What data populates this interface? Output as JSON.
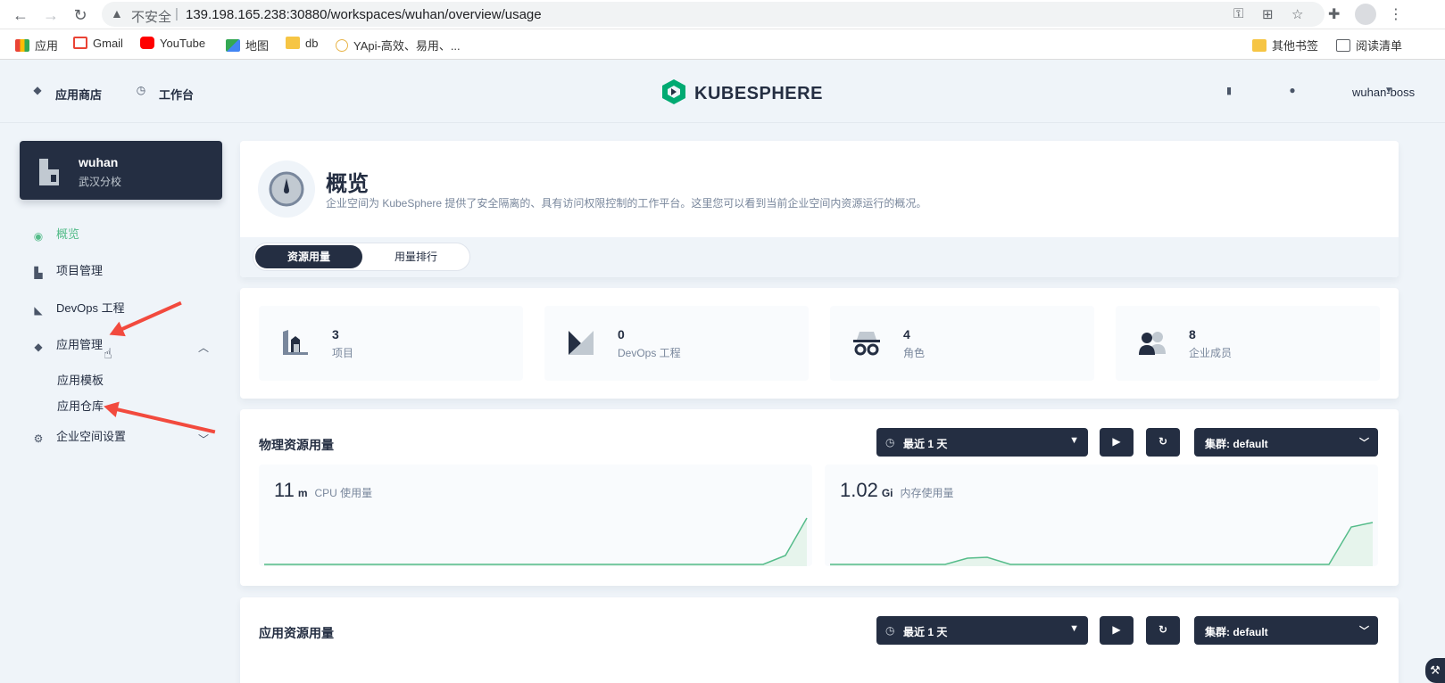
{
  "browser": {
    "insecure_label": "不安全",
    "url": "139.198.165.238:30880/workspaces/wuhan/overview/usage",
    "bookmarks": [
      "应用",
      "Gmail",
      "YouTube",
      "地图",
      "db",
      "YApi-高效、易用、..."
    ],
    "other_bookmarks": "其他书签",
    "reading_list": "阅读清单"
  },
  "header": {
    "app_store": "应用商店",
    "workbench": "工作台",
    "logo": "KUBESPHERE",
    "user": "wuhan-boss"
  },
  "workspace": {
    "name": "wuhan",
    "alias": "武汉分校"
  },
  "sidebar": {
    "overview": "概览",
    "projects": "项目管理",
    "devops": "DevOps 工程",
    "app_management": "应用管理",
    "app_templates": "应用模板",
    "app_repos": "应用仓库",
    "workspace_settings": "企业空间设置"
  },
  "overview": {
    "title": "概览",
    "description": "企业空间为 KubeSphere 提供了安全隔离的、具有访问权限控制的工作平台。这里您可以看到当前企业空间内资源运行的概况。",
    "tabs": [
      "资源用量",
      "用量排行"
    ]
  },
  "stats": [
    {
      "value": "3",
      "label": "项目"
    },
    {
      "value": "0",
      "label": "DevOps 工程"
    },
    {
      "value": "4",
      "label": "角色"
    },
    {
      "value": "8",
      "label": "企业成员"
    }
  ],
  "physical": {
    "title": "物理资源用量",
    "time_range": "最近 1 天",
    "cluster": "集群: default",
    "cpu": {
      "value": "11",
      "unit": "m",
      "label": "CPU 使用量"
    },
    "memory": {
      "value": "1.02",
      "unit": "Gi",
      "label": "内存使用量"
    }
  },
  "app_usage": {
    "title": "应用资源用量",
    "time_range": "最近 1 天",
    "cluster": "集群: default"
  },
  "colors": {
    "accent": "#55bc8a",
    "dark": "#242e42",
    "arrow": "#f24a3e"
  }
}
